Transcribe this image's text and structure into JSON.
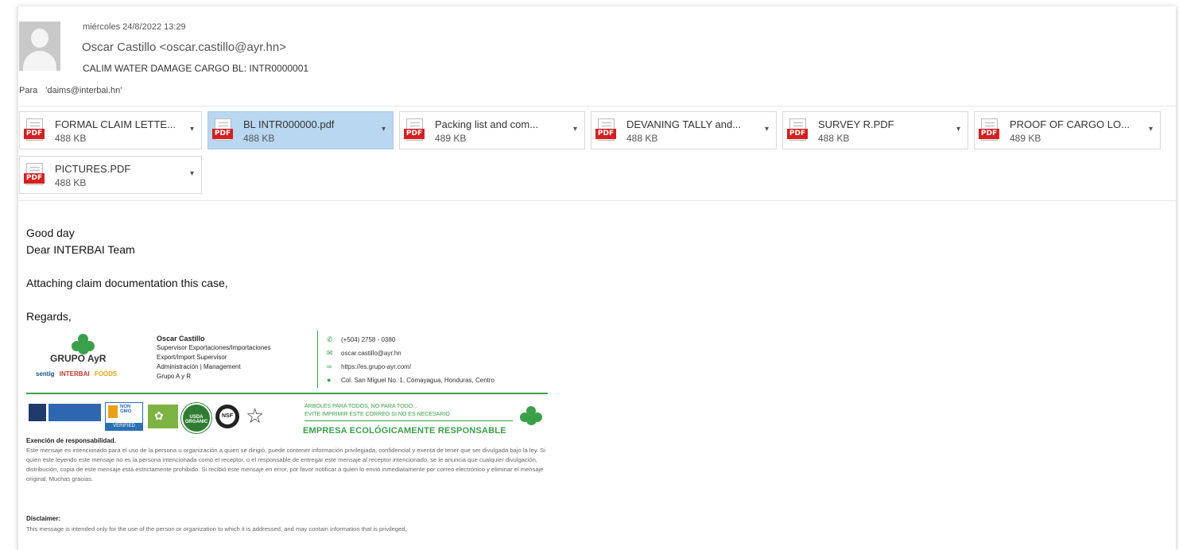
{
  "header": {
    "date": "miércoles 24/8/2022 13:29",
    "sender": "Oscar Castillo <oscar.castillo@ayr.hn>",
    "subject": "CALIM WATER DAMAGE CARGO BL: INTR0000001",
    "to_label": "Para",
    "to_value": "'daims@interbai.hn'"
  },
  "attachments": [
    {
      "name": "FORMAL CLAIM LETTE...",
      "size": "488 KB",
      "selected": false
    },
    {
      "name": "BL INTR000000.pdf",
      "size": "488 KB",
      "selected": true
    },
    {
      "name": "Packing list and com...",
      "size": "489 KB",
      "selected": false
    },
    {
      "name": "DEVANING TALLY and...",
      "size": "488 KB",
      "selected": false
    },
    {
      "name": "SURVEY R.PDF",
      "size": "488 KB",
      "selected": false
    },
    {
      "name": "PROOF OF CARGO LO...",
      "size": "489 KB",
      "selected": false
    },
    {
      "name": "PICTURES.PDF",
      "size": "488 KB",
      "selected": false
    }
  ],
  "attachment_icon_label": "PDF",
  "body": {
    "line1": "Good day",
    "line2": "Dear INTERBAI Team",
    "line3": "Attaching claim documentation this case,",
    "line4": "Regards,"
  },
  "signature": {
    "company": "GRUPO AyR",
    "brand1": "sentig",
    "brand2": "INTERBAI",
    "brand3": "FOODS",
    "name": "Oscar Castillo",
    "title1": "Supervisor Exportaciones/Importaciones",
    "title2": "Export/Import Supervisor",
    "title3": "Administración | Management",
    "title4": "Grupo A y R",
    "phone": "(+504) 2758 - 0380",
    "email": "oscar.castillo@ayr.hn",
    "web": "https://es.grupo-ayr.com/",
    "address": "Col. San Miguel No. 1, Comayagua, Honduras, Centro",
    "eco_small1": "ARBOLES PARA TODOS, NO PARA TODO...",
    "eco_small2": "EVITE IMPRIMIR ESTE CORREO SI NO ES NECESARIO",
    "eco_big": "EMPRESA ECOLÓGICAMENTE RESPONSABLE",
    "cert_labels": [
      "NON GMO",
      "VERIFIED",
      "USDA ORGANIC",
      "NSF"
    ]
  },
  "disclaimer": {
    "es_title": "Exención de responsabilidad.",
    "es_text": "Este mensaje es intencionado para el uso de la persona u organización a quien se dirigió, puede contener información privilegiada, confidencial y exenta de tener que ser divulgada bajo la ley. Si quien este leyendo este mensaje no es la persona intencionada como el receptor, o el responsable de entregar este mensaje al receptor intencionado, se le anuncia que cualquier divulgación, distribución, copia de este mensaje está estrictamente prohibido. Si recibió este mensaje en error, por favor notificar a quien lo envió inmediatamente por correo electrónico y eliminar el mensaje original. Muchas gracias.",
    "en_title": "Disclaimer:",
    "en_text": "This message is intended only for the use of the person or organization to which it is addressed, and may contain information that is privileged,"
  },
  "colors": {
    "selected_attachment": "#b9d7f0",
    "pdf_badge": "#d32020",
    "eco_green": "#3aa04a"
  }
}
